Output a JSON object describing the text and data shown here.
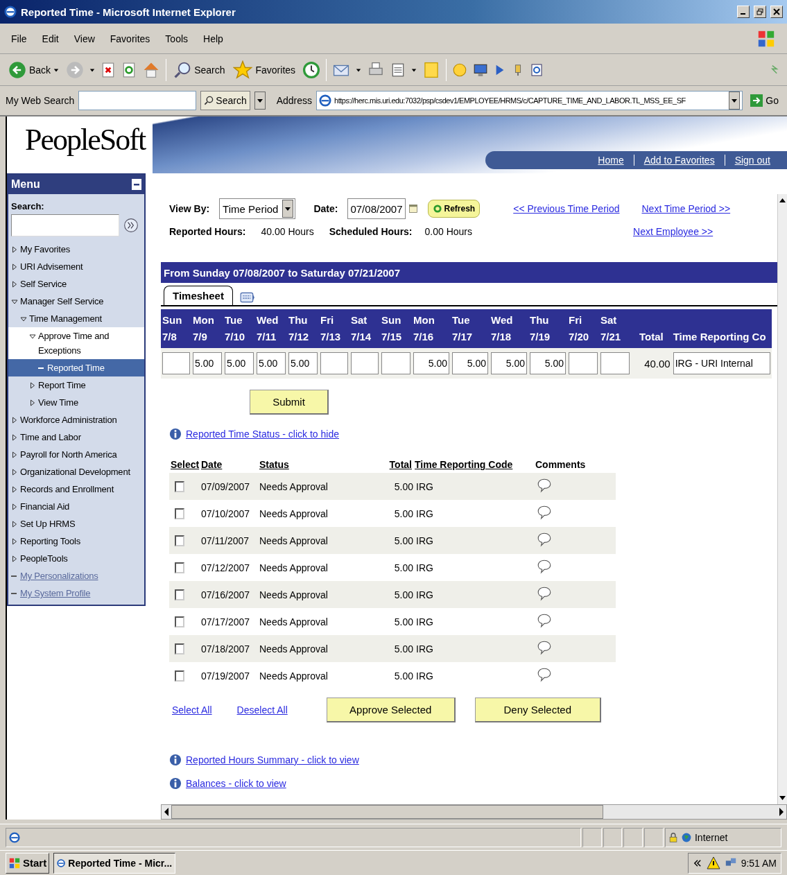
{
  "window": {
    "title": "Reported Time - Microsoft Internet Explorer"
  },
  "menu_bar": [
    "File",
    "Edit",
    "View",
    "Favorites",
    "Tools",
    "Help"
  ],
  "toolbar": {
    "back": "Back",
    "search": "Search",
    "favorites": "Favorites"
  },
  "address_bar": {
    "search_label": "My Web Search",
    "search_button": "Search",
    "address_label": "Address",
    "url": "https://herc.mis.uri.edu:7032/psp/csdev1/EMPLOYEE/HRMS/c/CAPTURE_TIME_AND_LABOR.TL_MSS_EE_SF",
    "go": "Go"
  },
  "header": {
    "logo": "PeopleSoft",
    "links": [
      "Home",
      "Add to Favorites",
      "Sign out"
    ]
  },
  "menu": {
    "title": "Menu",
    "search_label": "Search:",
    "items": [
      {
        "label": "My Favorites",
        "kind": "folder",
        "expanded": false,
        "selected": false
      },
      {
        "label": "URI Advisement",
        "kind": "folder",
        "expanded": false,
        "selected": false
      },
      {
        "label": "Self Service",
        "kind": "folder",
        "expanded": false,
        "selected": false
      },
      {
        "label": "Manager Self Service",
        "kind": "folder",
        "expanded": true,
        "selected": false,
        "children": [
          {
            "label": "Time Management",
            "kind": "folder",
            "expanded": true,
            "selected": false,
            "children": [
              {
                "label": "Approve Time and Exceptions",
                "kind": "folder",
                "expanded": true,
                "selected": false,
                "children": [
                  {
                    "label": "Reported Time",
                    "kind": "page",
                    "selected": true
                  }
                ]
              },
              {
                "label": "Report Time",
                "kind": "folder",
                "expanded": false,
                "selected": false
              },
              {
                "label": "View Time",
                "kind": "folder",
                "expanded": false,
                "selected": false
              }
            ]
          }
        ]
      },
      {
        "label": "Workforce Administration",
        "kind": "folder",
        "expanded": false,
        "selected": false
      },
      {
        "label": "Time and Labor",
        "kind": "folder",
        "expanded": false,
        "selected": false
      },
      {
        "label": "Payroll for North America",
        "kind": "folder",
        "expanded": false,
        "selected": false
      },
      {
        "label": "Organizational Development",
        "kind": "folder",
        "expanded": false,
        "selected": false
      },
      {
        "label": "Records and Enrollment",
        "kind": "folder",
        "expanded": false,
        "selected": false
      },
      {
        "label": "Financial Aid",
        "kind": "folder",
        "expanded": false,
        "selected": false
      },
      {
        "label": "Set Up HRMS",
        "kind": "folder",
        "expanded": false,
        "selected": false
      },
      {
        "label": "Reporting Tools",
        "kind": "folder",
        "expanded": false,
        "selected": false
      },
      {
        "label": "PeopleTools",
        "kind": "folder",
        "expanded": false,
        "selected": false
      },
      {
        "label": "My Personalizations",
        "kind": "link",
        "selected": false
      },
      {
        "label": "My System Profile",
        "kind": "link",
        "selected": false
      }
    ]
  },
  "filters": {
    "view_by_label": "View By:",
    "view_by_value": "Time Period",
    "date_label": "Date:",
    "date_value": "07/08/2007",
    "refresh": "Refresh",
    "previous_link": "<< Previous Time Period",
    "next_link": "Next Time Period >>",
    "next_employee_link": "Next Employee >>",
    "reported_label": "Reported Hours:",
    "reported_value": "40.00 Hours",
    "scheduled_label": "Scheduled Hours:",
    "scheduled_value": "0.00 Hours"
  },
  "timesheet": {
    "period": "From Sunday 07/08/2007 to Saturday 07/21/2007",
    "tab": "Timesheet",
    "days": [
      {
        "day": "Sun",
        "date": "7/8"
      },
      {
        "day": "Mon",
        "date": "7/9",
        "value": "5.00"
      },
      {
        "day": "Tue",
        "date": "7/10",
        "value": "5.00"
      },
      {
        "day": "Wed",
        "date": "7/11",
        "value": "5.00"
      },
      {
        "day": "Thu",
        "date": "7/12",
        "value": "5.00"
      },
      {
        "day": "Fri",
        "date": "7/13"
      },
      {
        "day": "Sat",
        "date": "7/14"
      },
      {
        "day": "Sun",
        "date": "7/15"
      },
      {
        "day": "Mon",
        "date": "7/16",
        "value": "5.00"
      },
      {
        "day": "Tue",
        "date": "7/17",
        "value": "5.00"
      },
      {
        "day": "Wed",
        "date": "7/18",
        "value": "5.00"
      },
      {
        "day": "Thu",
        "date": "7/19",
        "value": "5.00"
      },
      {
        "day": "Fri",
        "date": "7/20"
      },
      {
        "day": "Sat",
        "date": "7/21"
      }
    ],
    "total_label": "Total",
    "total": "40.00",
    "trc_label": "Time Reporting Co",
    "trc_value": "IRG - URI Internal"
  },
  "submit": "Submit",
  "status_section": {
    "link": "Reported Time Status - click to hide",
    "columns": [
      "Select",
      "Date",
      "Status",
      "Total",
      "Time Reporting Code",
      "Comments"
    ],
    "rows": [
      {
        "checked": false,
        "date": "07/09/2007",
        "status": "Needs Approval",
        "total": "5.00",
        "trc": "IRG"
      },
      {
        "checked": false,
        "date": "07/10/2007",
        "status": "Needs Approval",
        "total": "5.00",
        "trc": "IRG"
      },
      {
        "checked": false,
        "date": "07/11/2007",
        "status": "Needs Approval",
        "total": "5.00",
        "trc": "IRG"
      },
      {
        "checked": false,
        "date": "07/12/2007",
        "status": "Needs Approval",
        "total": "5.00",
        "trc": "IRG"
      },
      {
        "checked": false,
        "date": "07/16/2007",
        "status": "Needs Approval",
        "total": "5.00",
        "trc": "IRG"
      },
      {
        "checked": false,
        "date": "07/17/2007",
        "status": "Needs Approval",
        "total": "5.00",
        "trc": "IRG"
      },
      {
        "checked": false,
        "date": "07/18/2007",
        "status": "Needs Approval",
        "total": "5.00",
        "trc": "IRG"
      },
      {
        "checked": false,
        "date": "07/19/2007",
        "status": "Needs Approval",
        "total": "5.00",
        "trc": "IRG"
      }
    ]
  },
  "actions": {
    "select_all": "Select All",
    "deselect_all": "Deselect All",
    "approve": "Approve Selected",
    "deny": "Deny Selected"
  },
  "info_links": [
    "Reported Hours Summary - click to view",
    "Balances - click to view"
  ],
  "status_bar": {
    "zone": "Internet"
  },
  "taskbar": {
    "start": "Start",
    "task": "Reported Time - Micr...",
    "time": "9:51 AM"
  }
}
